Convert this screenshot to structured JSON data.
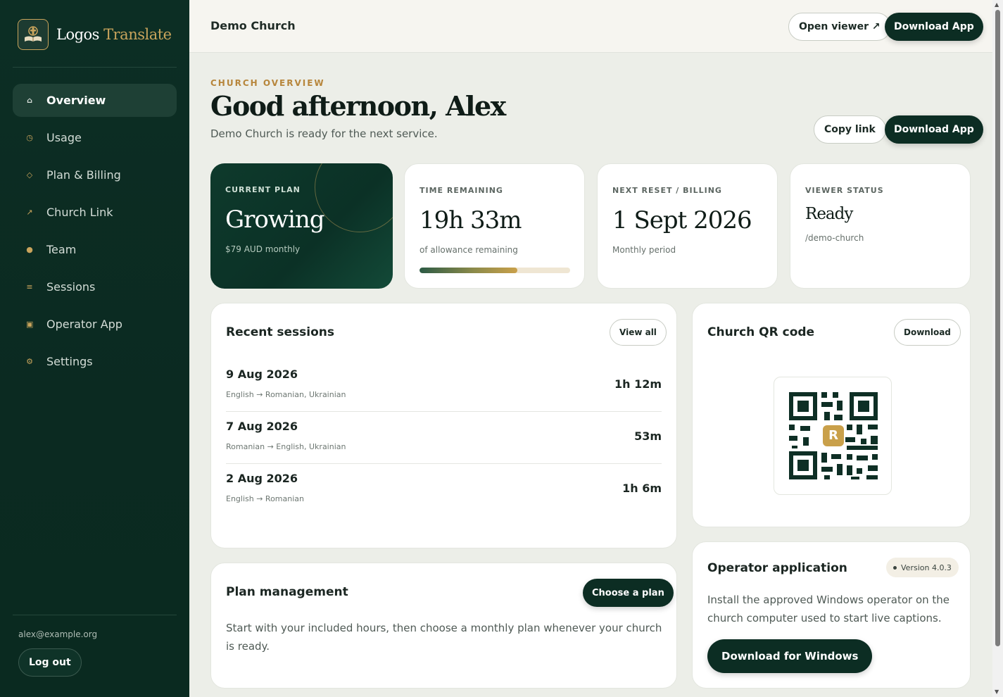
{
  "brand": {
    "name_part1": "Logos",
    "name_part2": "Translate",
    "logo_icon": "book-logo-icon"
  },
  "sidebar": {
    "items": [
      {
        "label": "Overview",
        "icon": "home-icon",
        "glyph": "⌂",
        "active": true
      },
      {
        "label": "Usage",
        "icon": "clock-icon",
        "glyph": "◷",
        "active": false
      },
      {
        "label": "Plan & Billing",
        "icon": "diamond-icon",
        "glyph": "◇",
        "active": false
      },
      {
        "label": "Church Link",
        "icon": "arrow-link-icon",
        "glyph": "↗",
        "active": false
      },
      {
        "label": "Team",
        "icon": "info-icon",
        "glyph": "●",
        "active": false
      },
      {
        "label": "Sessions",
        "icon": "list-icon",
        "glyph": "≡",
        "active": false
      },
      {
        "label": "Operator App",
        "icon": "app-window-icon",
        "glyph": "▣",
        "active": false
      },
      {
        "label": "Settings",
        "icon": "gear-icon",
        "glyph": "⚙",
        "active": false
      }
    ],
    "user_email": "alex@example.org",
    "logout_label": "Log out"
  },
  "header": {
    "church_name": "Demo Church",
    "open_viewer_label": "Open viewer ↗",
    "download_app_label": "Download App"
  },
  "hero": {
    "kicker": "CHURCH OVERVIEW",
    "greeting": "Good afternoon, Alex",
    "subline": "Demo Church is ready for the next service.",
    "copy_link_label": "Copy link",
    "download_app_label": "Download App"
  },
  "stats": {
    "plan": {
      "label": "CURRENT PLAN",
      "value": "Growing",
      "sub": "$79 AUD monthly"
    },
    "time": {
      "label": "TIME REMAINING",
      "value": "19h 33m",
      "sub": "of allowance remaining",
      "progress_fraction": 0.65
    },
    "reset": {
      "label": "NEXT RESET / BILLING",
      "value": "1 Sept 2026",
      "sub": "Monthly period"
    },
    "viewer": {
      "label": "VIEWER STATUS",
      "value": "Ready",
      "sub": "/demo-church"
    }
  },
  "recent_sessions": {
    "title": "Recent sessions",
    "view_all_label": "View all",
    "rows": [
      {
        "date": "9 Aug 2026",
        "langs": "English → Romanian, Ukrainian",
        "duration": "1h 12m"
      },
      {
        "date": "7 Aug 2026",
        "langs": "Romanian → English, Ukrainian",
        "duration": "53m"
      },
      {
        "date": "2 Aug 2026",
        "langs": "English → Romanian",
        "duration": "1h 6m"
      }
    ]
  },
  "qr": {
    "title": "Church QR code",
    "download_label": "Download",
    "center_letter": "R"
  },
  "plan_management": {
    "title": "Plan management",
    "choose_label": "Choose a plan",
    "text": "Start with your included hours, then choose a monthly plan whenever your church is ready."
  },
  "operator": {
    "title": "Operator application",
    "version": "Version 4.0.3",
    "text": "Install the approved Windows operator on the church computer used to start live captions.",
    "download_label": "Download for Windows"
  },
  "colors": {
    "sidebar_bg": "#0c2e24",
    "accent_gold": "#c9a45c",
    "primary_dark": "#0c2d23",
    "page_bg": "#eceee8"
  }
}
